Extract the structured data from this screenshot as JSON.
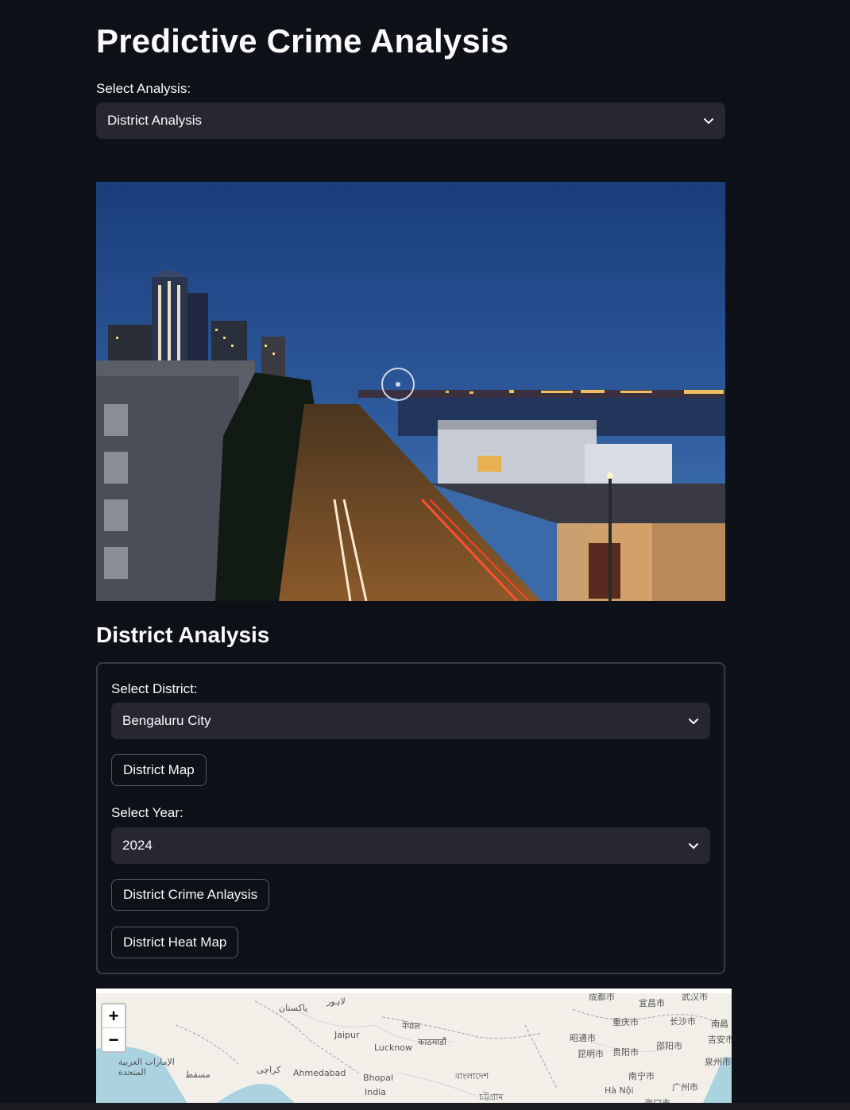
{
  "page": {
    "title": "Predictive Crime Analysis"
  },
  "analysis_select": {
    "label": "Select Analysis:",
    "value": "District Analysis"
  },
  "hero_image": {
    "icon": "city-night-waterfront-image"
  },
  "district_section": {
    "title": "District Analysis",
    "district_select": {
      "label": "Select District:",
      "value": "Bengaluru City"
    },
    "district_map_button": "District Map",
    "year_select": {
      "label": "Select Year:",
      "value": "2024"
    },
    "crime_analysis_button": "District Crime Anlaysis",
    "heat_map_button": "District Heat Map"
  },
  "map": {
    "zoom_in": "+",
    "zoom_out": "−",
    "labels": [
      "پاکستان",
      "لاہور",
      "Jaipur",
      "Lucknow",
      "नेपाल",
      "काठमाडौं",
      "الإمارات العربية المتحدة",
      "مسقط",
      "کراچی",
      "Ahmedabad",
      "Bhopal",
      "India",
      "বাংলাদেশ",
      "চট্টগ্রাম",
      "昭通市",
      "昆明市",
      "贵阳市",
      "重庆市",
      "宜昌市",
      "长沙市",
      "邵阳市",
      "南宁市",
      "广州市",
      "Hà Nội",
      "海口市",
      "武汉市",
      "成都市",
      "吉安市",
      "泉州市",
      "南昌"
    ]
  },
  "colors": {
    "background": "#0e1117",
    "input": "#262730",
    "text": "#fafafa"
  }
}
